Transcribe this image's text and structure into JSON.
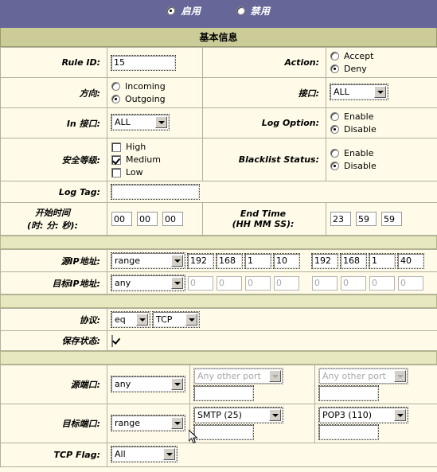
{
  "banner": {
    "enable_label": "启用",
    "disable_label": "禁用",
    "selected": "启用",
    "bg_color": "#666699"
  },
  "section_basic": {
    "title": "基本信息",
    "header_bg": "#cccc99"
  },
  "rows": {
    "rule_id": {
      "label": "Rule ID:",
      "value": "15"
    },
    "action": {
      "label": "Action:",
      "options": [
        "Accept",
        "Deny"
      ],
      "selected": "Deny"
    },
    "direction": {
      "label": "方向:",
      "options": [
        "Incoming",
        "Outgoing"
      ],
      "selected": "Outgoing"
    },
    "interface": {
      "label": "接口:",
      "value": "ALL"
    },
    "in_interface": {
      "label": "In 接口:",
      "value": "ALL"
    },
    "log_option": {
      "label": "Log Option:",
      "options": [
        "Enable",
        "Disable"
      ],
      "selected": "Disable"
    },
    "security_level": {
      "label": "安全等级:",
      "options": [
        "High",
        "Medium",
        "Low"
      ],
      "checked": [
        "Medium"
      ]
    },
    "blacklist_status": {
      "label": "Blacklist Status:",
      "options": [
        "Enable",
        "Disable"
      ],
      "selected": "Disable"
    },
    "log_tag": {
      "label": "Log Tag:",
      "value": ""
    },
    "start_time": {
      "label_line1": "开始时间",
      "label_line2": "(时: 分: 秒):",
      "hh": "00",
      "mm": "00",
      "ss": "00"
    },
    "end_time": {
      "label_line1": "End Time",
      "label_line2": "(HH MM SS):",
      "hh": "23",
      "mm": "59",
      "ss": "59"
    },
    "src_ip": {
      "label": "源IP地址:",
      "mode": "range",
      "octets_a": [
        "192",
        "168",
        "1",
        "10"
      ],
      "octets_b": [
        "192",
        "168",
        "1",
        "40"
      ],
      "disabled": false
    },
    "dst_ip": {
      "label": "目标IP地址:",
      "mode": "any",
      "octets_a": [
        "0",
        "0",
        "0",
        "0"
      ],
      "octets_b": [
        "0",
        "0",
        "0",
        "0"
      ],
      "disabled": true
    },
    "protocol": {
      "label": "协议:",
      "operator": "eq",
      "value": "TCP"
    },
    "save_state": {
      "label": "保存状态:",
      "checked": true
    },
    "src_port": {
      "label": "源端口:",
      "mode": "any",
      "port_a_name": "Any other port",
      "port_a_value": "",
      "port_b_name": "Any other port",
      "port_b_value": "",
      "disabled": true
    },
    "dst_port": {
      "label": "目标端口:",
      "mode": "range",
      "port_a_name": "SMTP (25)",
      "port_a_value": "",
      "port_b_name": "POP3 (110)",
      "port_b_value": "",
      "disabled": false
    },
    "tcp_flag": {
      "label": "TCP Flag:",
      "value": "All"
    }
  }
}
